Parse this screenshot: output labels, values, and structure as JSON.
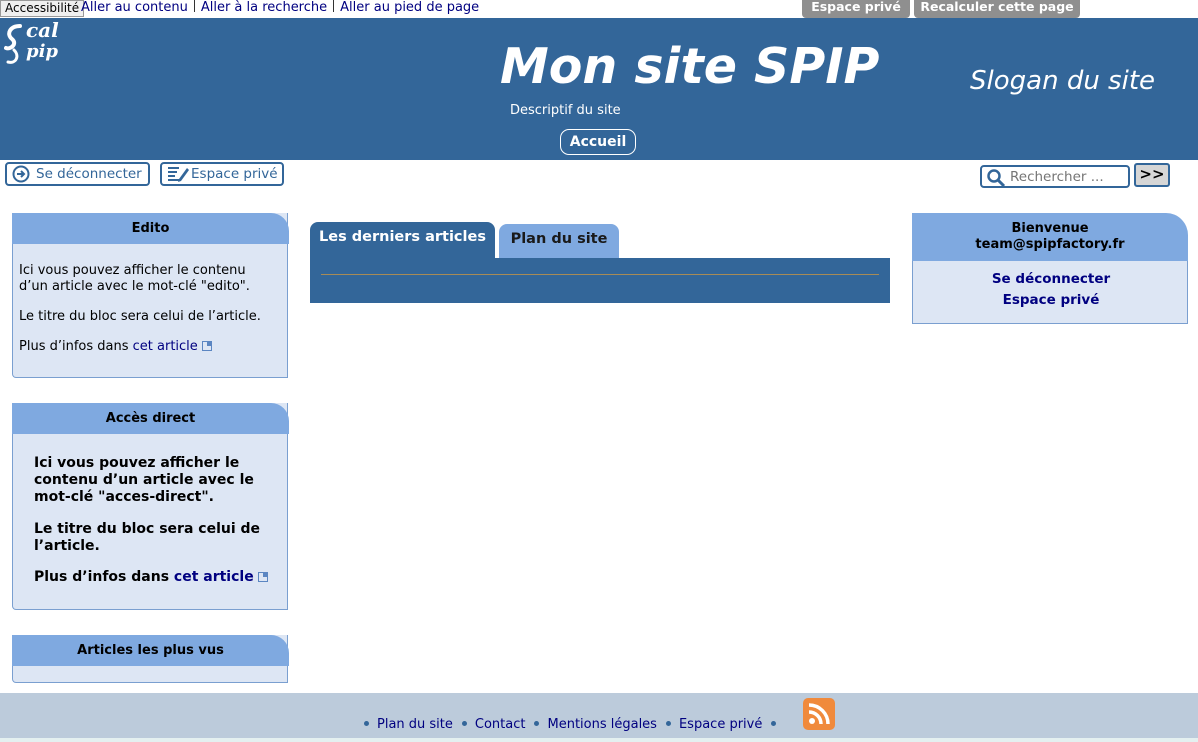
{
  "topbar": {
    "accessibility_label": "Accessibilité",
    "skip_links": [
      "Aller au contenu",
      "Aller à la recherche",
      "Aller au pied de page"
    ],
    "admin_buttons": [
      "Espace privé",
      "Recalculer cette page"
    ]
  },
  "header": {
    "logo_text_1": "cal",
    "logo_text_2": "pip",
    "title": "Mon site SPIP",
    "slogan": "Slogan du site",
    "description": "Descriptif du site",
    "nav_home": "Accueil"
  },
  "user_bar": {
    "logout_label": "Se déconnecter",
    "private_label": "Espace privé"
  },
  "search": {
    "placeholder": "Rechercher ...",
    "submit_label": ">>"
  },
  "left_sidebar": {
    "edito": {
      "title": "Edito",
      "line1": "Ici vous pouvez afficher le contenu",
      "line2": "d’un article avec le mot-clé \"edito\".",
      "line3": "Le titre du bloc sera celui de l’article.",
      "more_prefix": "Plus d’infos dans ",
      "more_link": "cet article"
    },
    "acces_direct": {
      "title": "Accès direct",
      "line1": "Ici vous pouvez afficher le",
      "line2": "contenu d’un article avec le",
      "line3": "mot-clé \"acces-direct\".",
      "line4": "Le titre du bloc sera celui de",
      "line5": "l’article.",
      "more_prefix": "Plus d’infos dans ",
      "more_link": "cet article"
    },
    "popular": {
      "title": "Articles les plus vus"
    }
  },
  "main": {
    "tabs": [
      {
        "label": "Les derniers articles",
        "active": true
      },
      {
        "label": "Plan du site",
        "active": false
      }
    ]
  },
  "right_sidebar": {
    "welcome_line1": "Bienvenue",
    "welcome_line2": "team@spipfactory.fr",
    "logout_link": "Se déconnecter",
    "private_link": "Espace privé"
  },
  "footer": {
    "links": [
      "Plan du site",
      "Contact",
      "Mentions légales",
      "Espace privé"
    ],
    "rss_icon": "rss-icon"
  },
  "colors": {
    "header_bg": "#336699",
    "box_head": "#7fa9e0",
    "box_body": "#dde6f4",
    "footer_bg": "#bccbdb",
    "link": "#000080",
    "rss": "#f08a3c"
  }
}
